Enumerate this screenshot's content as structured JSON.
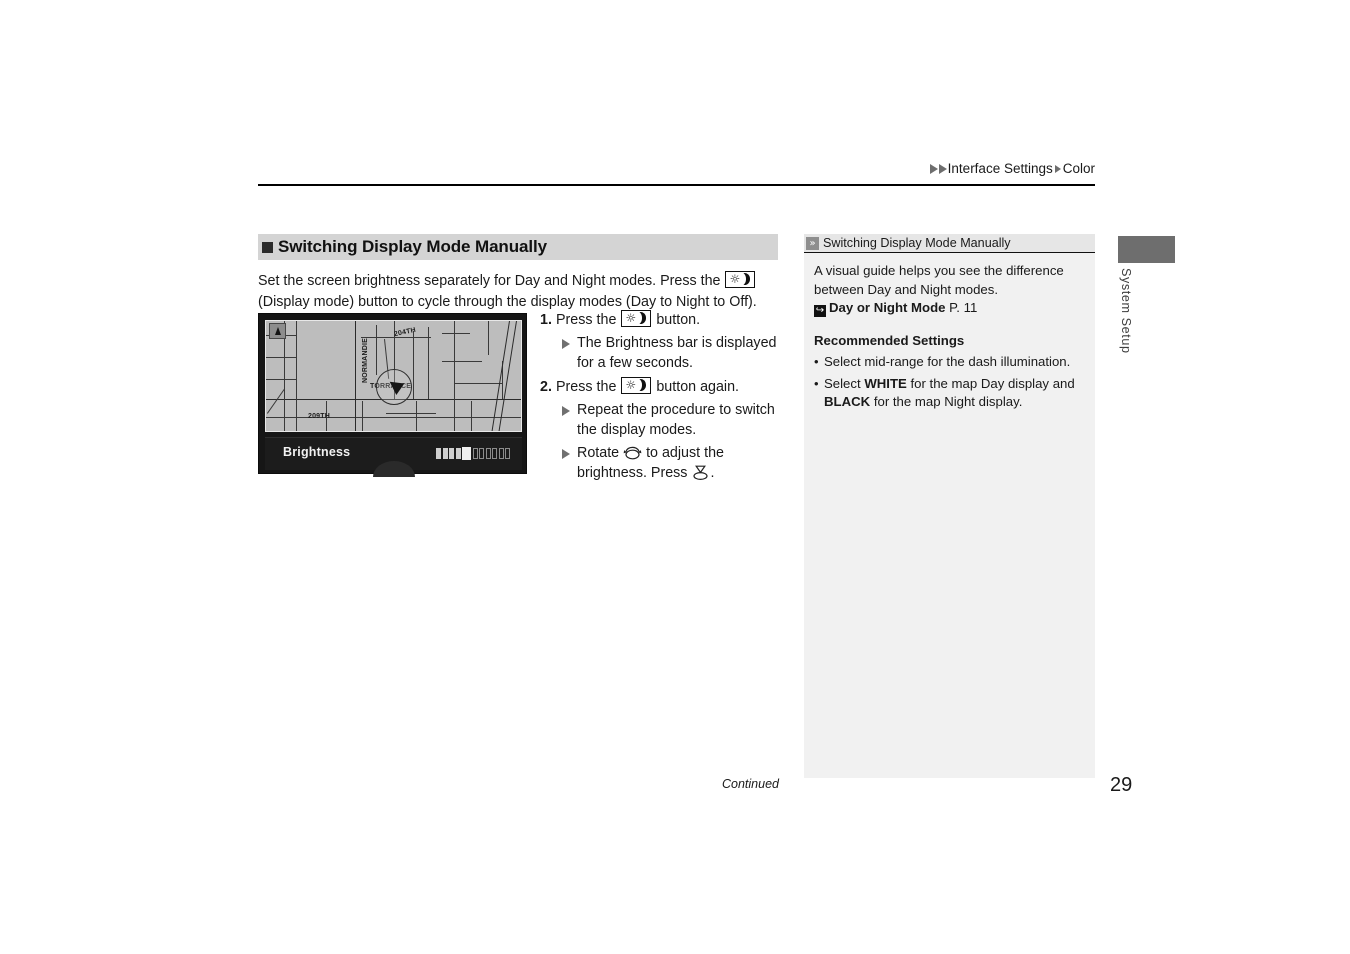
{
  "header": {
    "breadcrumb_parent": "Interface Settings",
    "breadcrumb_child": "Color"
  },
  "section": {
    "title": "Switching Display Mode Manually",
    "intro_part1": "Set the screen brightness separately for Day and Night modes. Press the ",
    "intro_part2": "(Display mode) button to cycle through the display modes (Day to Night to Off)."
  },
  "figure": {
    "brightness_label": "Brightness",
    "map_labels": {
      "normandie": "NORMANDIE",
      "street_204th": "204TH",
      "street_209th": "209TH",
      "torrance": "TORRANCE"
    },
    "brightness_segments_on": 4,
    "brightness_segments_off": 7
  },
  "steps": [
    {
      "num": "1.",
      "text_before": "Press the ",
      "text_after": " button.",
      "subs": [
        "The Brightness bar is displayed for a few seconds."
      ]
    },
    {
      "num": "2.",
      "text_before": "Press the ",
      "text_after": " button again.",
      "subs": [
        "Repeat the procedure to switch the display modes."
      ]
    }
  ],
  "rotate_step": {
    "before": "Rotate ",
    "middle": " to adjust the brightness. Press ",
    "after": "."
  },
  "sidebar": {
    "title": "Switching Display Mode Manually",
    "paragraph": "A visual guide helps you see the difference between Day and Night modes.",
    "xref_label": "Day or Night Mode",
    "xref_page": " P. 11",
    "recommended_heading": "Recommended Settings",
    "bullets": [
      {
        "prefix": "Select mid-range for the dash illumination.",
        "bold1": "",
        "mid": "",
        "bold2": "",
        "suffix": ""
      },
      {
        "prefix": "Select ",
        "bold1": "WHITE",
        "mid": " for the map Day display and ",
        "bold2": "BLACK",
        "suffix": " for the map Night display."
      }
    ]
  },
  "edge_tab": {
    "label": "System Setup"
  },
  "footer": {
    "continued": "Continued",
    "page_number": "29"
  },
  "colors": {
    "title_band": "#d4d4d4",
    "sidebar_bg": "#f1f1f1",
    "tab_gray": "#6e6e6e"
  }
}
